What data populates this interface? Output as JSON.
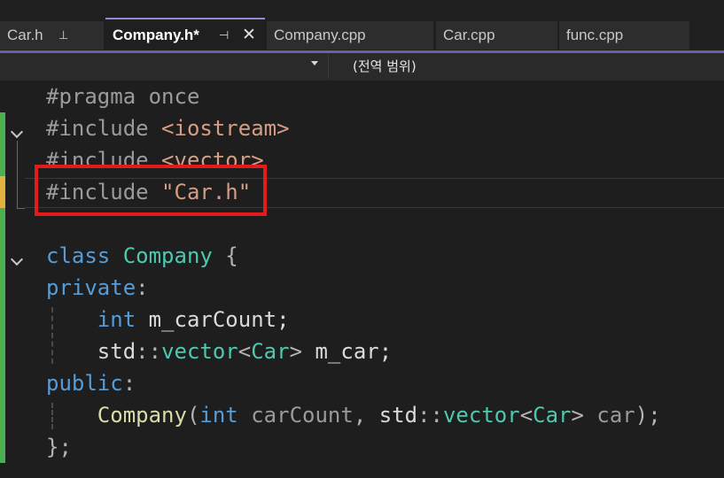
{
  "tabs": [
    {
      "label": "Car.h",
      "pin": "⊥"
    },
    {
      "label": "Company.h*",
      "pin": "⊣",
      "close": "✕"
    },
    {
      "label": "Company.cpp"
    },
    {
      "label": "Car.cpp"
    },
    {
      "label": "func.cpp"
    }
  ],
  "navbar": {
    "scope": "(전역 범위)"
  },
  "code": {
    "l1": {
      "pre": "#pragma once"
    },
    "l2": {
      "pre": "#include ",
      "str": "<iostream>"
    },
    "l3": {
      "pre": "#include ",
      "str": "<vector>"
    },
    "l4": {
      "pre": "#include ",
      "str": "\"Car.h\""
    },
    "l6": {
      "kw": "class",
      "type": "Company",
      "punc": " {"
    },
    "l7": {
      "kw": "private",
      "punc": ":"
    },
    "l8": {
      "kw": "int",
      "id": " m_carCount;"
    },
    "l9": {
      "id1": "std",
      "punc1": "::",
      "type1": "vector",
      "punc2": "<",
      "type2": "Car",
      "punc3": "> ",
      "id2": "m_car;"
    },
    "l10": {
      "kw": "public",
      "punc": ":"
    },
    "l11": {
      "fn": "Company",
      "punc1": "(",
      "kw": "int",
      "param1": " carCount",
      "punc2": ", ",
      "id1": "std",
      "punc3": "::",
      "type1": "vector",
      "punc4": "<",
      "type2": "Car",
      "punc5": "> ",
      "param2": "car",
      "punc6": ");"
    },
    "l12": {
      "punc": "};"
    }
  },
  "colors": {
    "accent": "#9b86d6",
    "highlight_box": "#e41b1b",
    "change_bar": "#4caf50"
  }
}
